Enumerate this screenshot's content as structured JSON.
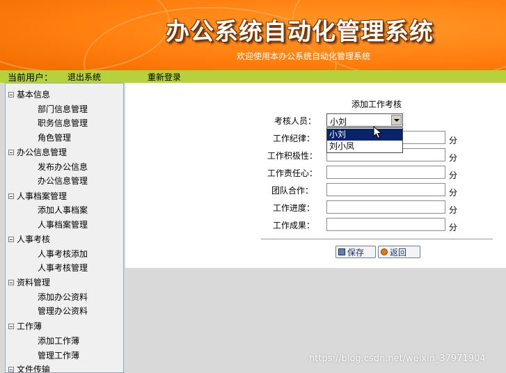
{
  "header": {
    "title": "办公系统自动化管理系统",
    "subtitle": "欢迎使用本办公系统自动化管理系统"
  },
  "userbar": {
    "current_user_label": "当前用户：",
    "logout": "退出系统",
    "relogin": "重新登录"
  },
  "sidebar": {
    "groups": [
      {
        "label": "基本信息",
        "items": [
          "部门信息管理",
          "职务信息管理",
          "角色管理"
        ]
      },
      {
        "label": "办公信息管理",
        "items": [
          "发布办公信息",
          "办公信息管理"
        ]
      },
      {
        "label": "人事档案管理",
        "items": [
          "添加人事档案",
          "人事档案管理"
        ]
      },
      {
        "label": "人事考核",
        "items": [
          "人事考核添加",
          "人事考核管理"
        ]
      },
      {
        "label": "资料管理",
        "items": [
          "添加办公资料",
          "管理办公资料"
        ]
      },
      {
        "label": "工作薄",
        "items": [
          "添加工作薄",
          "管理工作薄"
        ]
      },
      {
        "label": "文件传输",
        "items": []
      }
    ]
  },
  "form": {
    "title": "添加工作考核",
    "person_label": "考核人员：",
    "person_selected": "小刘",
    "person_options": [
      "小刘",
      "刘小凤"
    ],
    "fields": [
      {
        "label": "工作纪律：",
        "unit": "分"
      },
      {
        "label": "工作积极性：",
        "unit": "分"
      },
      {
        "label": "工作责任心：",
        "unit": "分"
      },
      {
        "label": "团队合作：",
        "unit": "分"
      },
      {
        "label": "工作进度：",
        "unit": "分"
      },
      {
        "label": "工作成果：",
        "unit": "分"
      }
    ],
    "save_button": "保存",
    "back_button": "返回"
  },
  "watermark": "https://blog.csdn.net/weixin_37971904",
  "colors": {
    "banner": "#ff7f0f",
    "userbar": "#b6d13b",
    "selection": "#0a246a"
  }
}
